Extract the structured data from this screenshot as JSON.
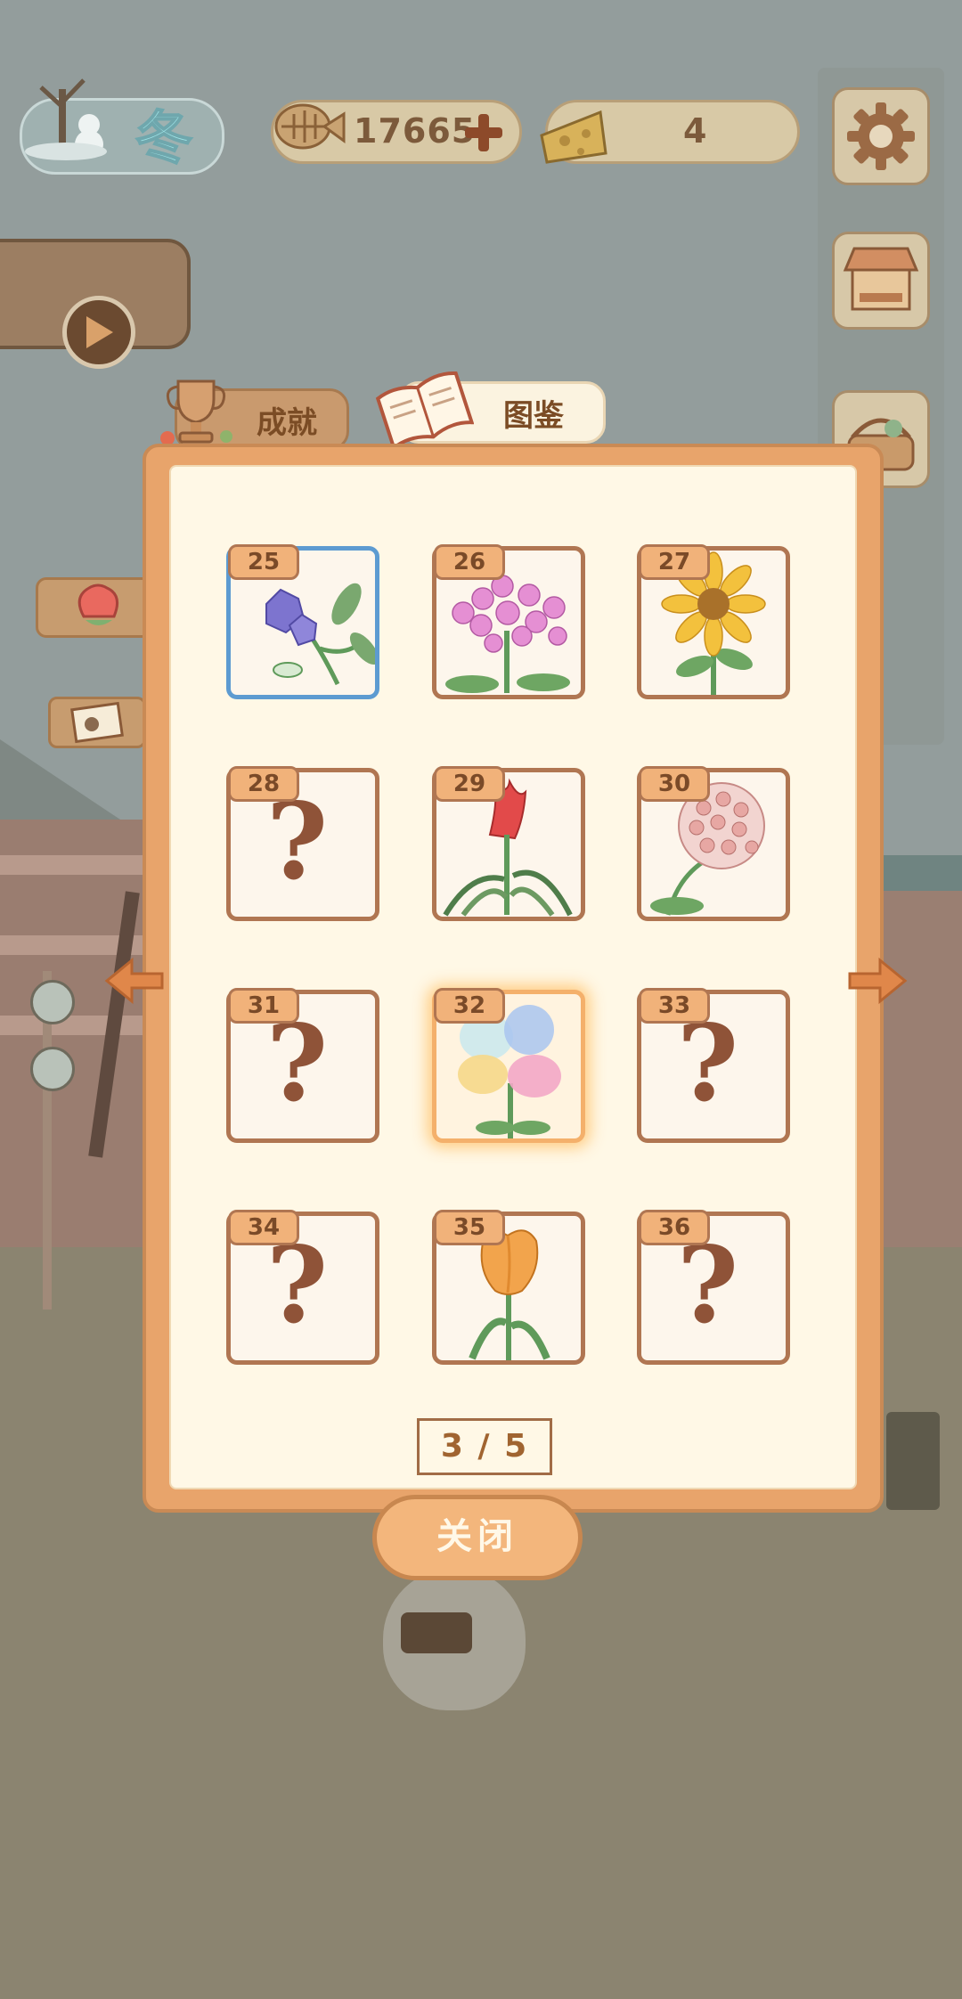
{
  "top_bar": {
    "season_label": "冬",
    "fish_currency": "17665",
    "cheese_currency": "4"
  },
  "tabs": [
    {
      "label": "成就",
      "active": false
    },
    {
      "label": "图鉴",
      "active": true
    }
  ],
  "catalog": {
    "items": [
      {
        "number": "25",
        "unlocked": true,
        "flower": "purple bellflower",
        "state": "selected"
      },
      {
        "number": "26",
        "unlocked": true,
        "flower": "pink phlox",
        "state": "normal"
      },
      {
        "number": "27",
        "unlocked": true,
        "flower": "sunflower",
        "state": "normal"
      },
      {
        "number": "28",
        "unlocked": false,
        "state": "locked"
      },
      {
        "number": "29",
        "unlocked": true,
        "flower": "red celosia",
        "state": "normal"
      },
      {
        "number": "30",
        "unlocked": true,
        "flower": "hoya cluster",
        "state": "normal"
      },
      {
        "number": "31",
        "unlocked": false,
        "state": "locked"
      },
      {
        "number": "32",
        "unlocked": true,
        "flower": "rainbow petals",
        "state": "highlighted"
      },
      {
        "number": "33",
        "unlocked": false,
        "state": "locked"
      },
      {
        "number": "34",
        "unlocked": false,
        "state": "locked"
      },
      {
        "number": "35",
        "unlocked": true,
        "flower": "orange tulip",
        "state": "normal"
      },
      {
        "number": "36",
        "unlocked": false,
        "state": "locked"
      }
    ],
    "locked_symbol": "?",
    "page_indicator": "3 / 5"
  },
  "close_button": "关闭",
  "colors": {
    "modal_frame": "#e8a46b",
    "modal_inner": "#fff8e6",
    "card_border": "#b07652",
    "selected_border": "#5d9bd1",
    "arrow": "#e0874a"
  },
  "icons": [
    "snow-tree-icon",
    "fish-bone-icon",
    "plus-icon",
    "cheese-icon",
    "gear-icon",
    "shop-stall-icon",
    "basket-icon",
    "play-icon",
    "trophy-icon",
    "book-icon",
    "rose-icon",
    "photo-icon",
    "left-arrow-icon",
    "right-arrow-icon"
  ]
}
